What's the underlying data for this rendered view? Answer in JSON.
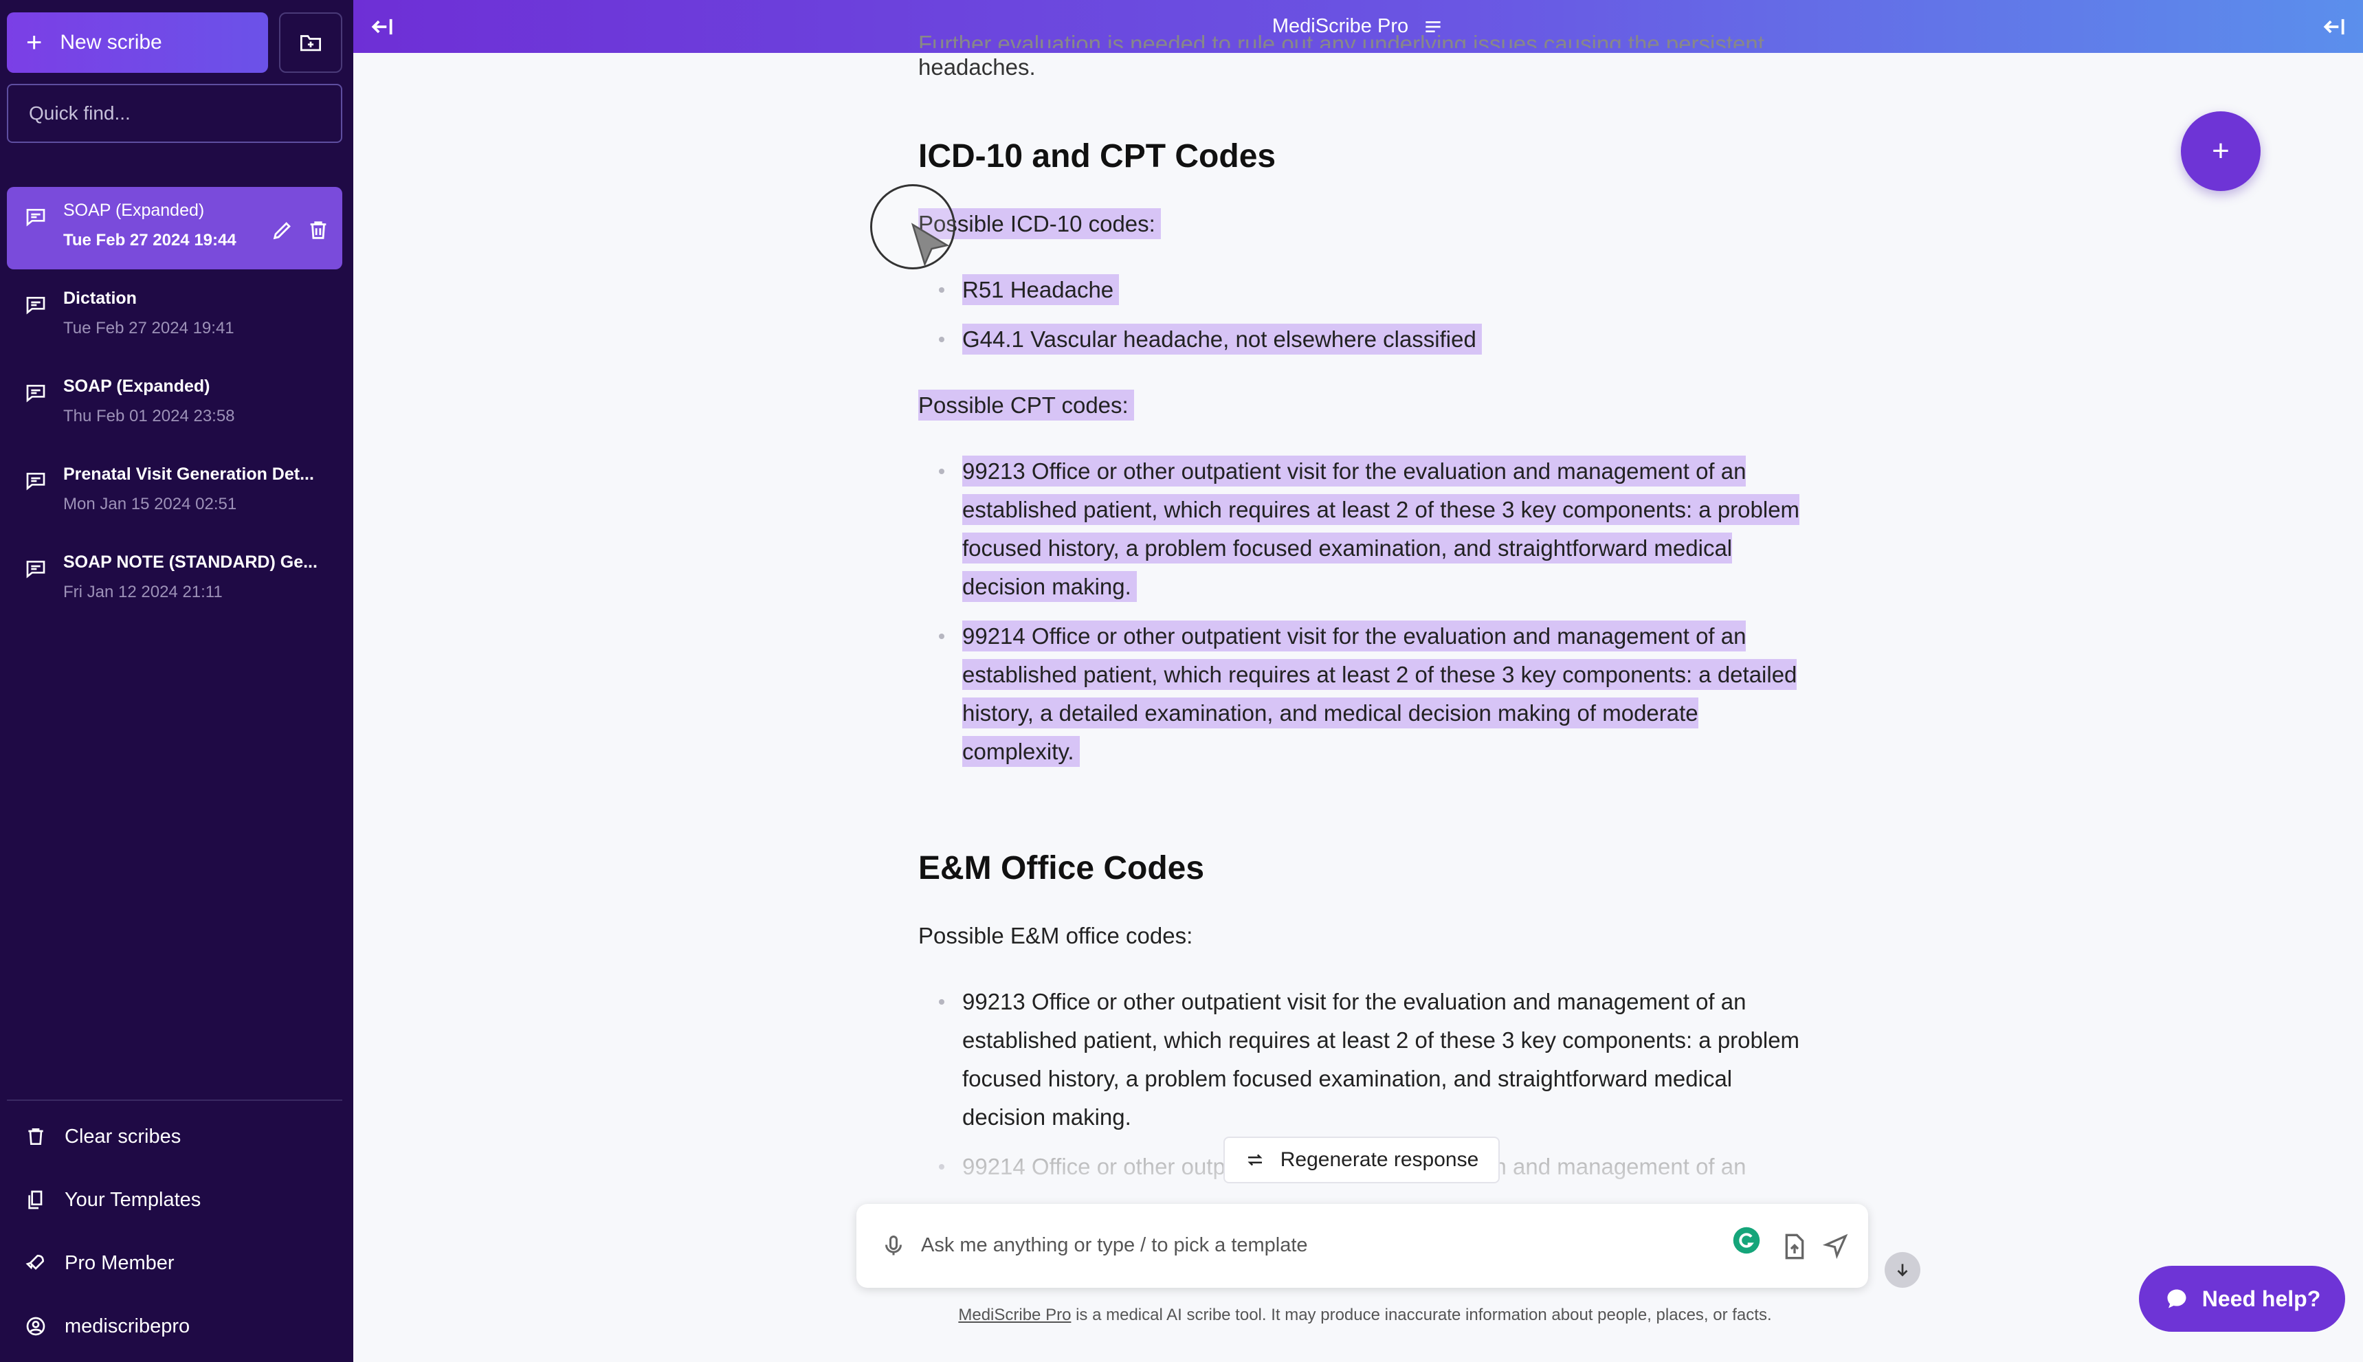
{
  "sidebar": {
    "new_scribe_label": "New scribe",
    "quick_find_placeholder": "Quick find...",
    "scribes": [
      {
        "title": "SOAP (Expanded)",
        "date": "Tue Feb 27 2024 19:44",
        "active": true
      },
      {
        "title": "Dictation",
        "date": "Tue Feb 27 2024 19:41"
      },
      {
        "title": "SOAP (Expanded)",
        "date": "Thu Feb 01 2024 23:58"
      },
      {
        "title": "Prenatal Visit Generation Det...",
        "date": "Mon Jan 15 2024 02:51"
      },
      {
        "title": "SOAP NOTE (STANDARD) Ge...",
        "date": "Fri Jan 12 2024 21:11"
      }
    ],
    "menu": {
      "clear_scribes": "Clear scribes",
      "your_templates": "Your Templates",
      "pro_member": "Pro Member",
      "username": "mediscribepro"
    }
  },
  "topbar": {
    "title": "MediScribe Pro"
  },
  "document": {
    "intro_cut": "Further evaluation is needed to rule out any underlying issues causing the persistent",
    "intro_end": "headaches.",
    "section1": {
      "heading": "ICD-10 and CPT Codes",
      "icd_label": "Possible ICD-10 codes:",
      "icd_codes": [
        "R51 Headache",
        "G44.1 Vascular headache, not elsewhere classified"
      ],
      "cpt_label": "Possible CPT codes:",
      "cpt_codes": [
        "99213 Office or other outpatient visit for the evaluation and management of an established patient, which requires at least 2 of these 3 key components: a problem focused history, a problem focused examination, and straightforward medical decision making.",
        "99214 Office or other outpatient visit for the evaluation and management of an established patient, which requires at least 2 of these 3 key components: a detailed history, a detailed examination, and medical decision making of moderate complexity."
      ]
    },
    "section2": {
      "heading": "E&M Office Codes",
      "label": "Possible E&M office codes:",
      "codes": [
        "99213 Office or other outpatient visit for the evaluation and management of an established patient, which requires at least 2 of these 3 key components: a problem focused history, a problem focused examination, and straightforward medical decision making.",
        "99214 Office or other outpatient visit for the evaluation and management of an"
      ]
    }
  },
  "regenerate_label": "Regenerate response",
  "input": {
    "placeholder": "Ask me anything or type / to pick a template"
  },
  "disclaimer": {
    "link": "MediScribe Pro",
    "text": " is a medical AI scribe tool. It may produce inaccurate information about people, places, or facts."
  },
  "help_label": "Need help?",
  "colors": {
    "sidebar_bg": "#1f0a45",
    "accent": "#6e34d6",
    "highlight": "#d7c4f6"
  }
}
